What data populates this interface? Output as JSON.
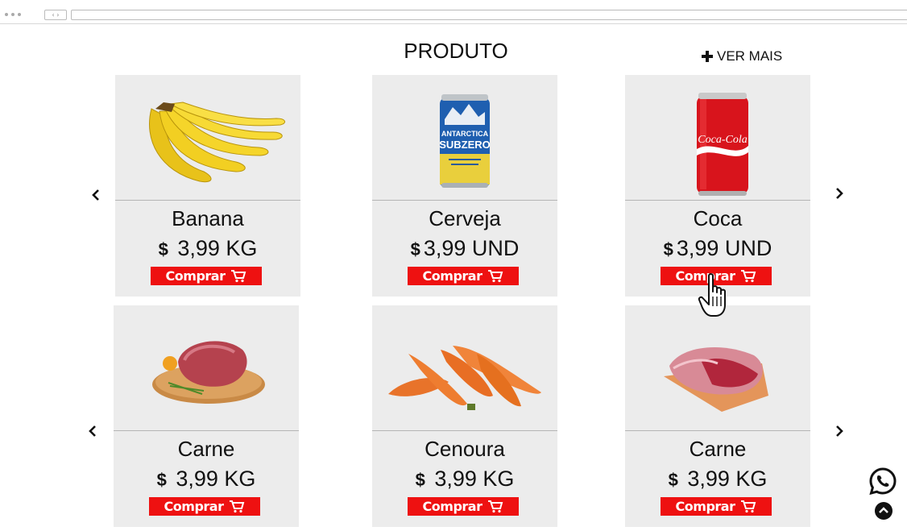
{
  "browser": {
    "nav_glyph": "‹ ›"
  },
  "section": {
    "title": "PRODUTO",
    "ver_mais": "VER MAIS"
  },
  "products": [
    {
      "name": "Banana",
      "currency": "$",
      "price": "3,99 KG"
    },
    {
      "name": "Cerveja",
      "currency": "$",
      "price": "3,99 UND"
    },
    {
      "name": "Coca",
      "currency": "$",
      "price": "3,99 UND"
    },
    {
      "name": "Carne",
      "currency": "$",
      "price": "3,99 KG"
    },
    {
      "name": "Cenoura",
      "currency": "$",
      "price": "3,99 KG"
    },
    {
      "name": "Carne",
      "currency": "$",
      "price": "3,99 KG"
    }
  ],
  "can_labels": {
    "beer": [
      "ANTARCTICA",
      "SUBZERO"
    ],
    "coke": "Coca-Cola"
  },
  "buy_label": "Comprar",
  "colors": {
    "buy_button": "#ee1111",
    "card_bg": "#ececec",
    "text": "#111111"
  },
  "icons": [
    "plus-icon",
    "chevron-left-icon",
    "chevron-right-icon",
    "cart-icon",
    "whatsapp-icon",
    "arrow-up-icon",
    "hand-cursor-icon"
  ]
}
